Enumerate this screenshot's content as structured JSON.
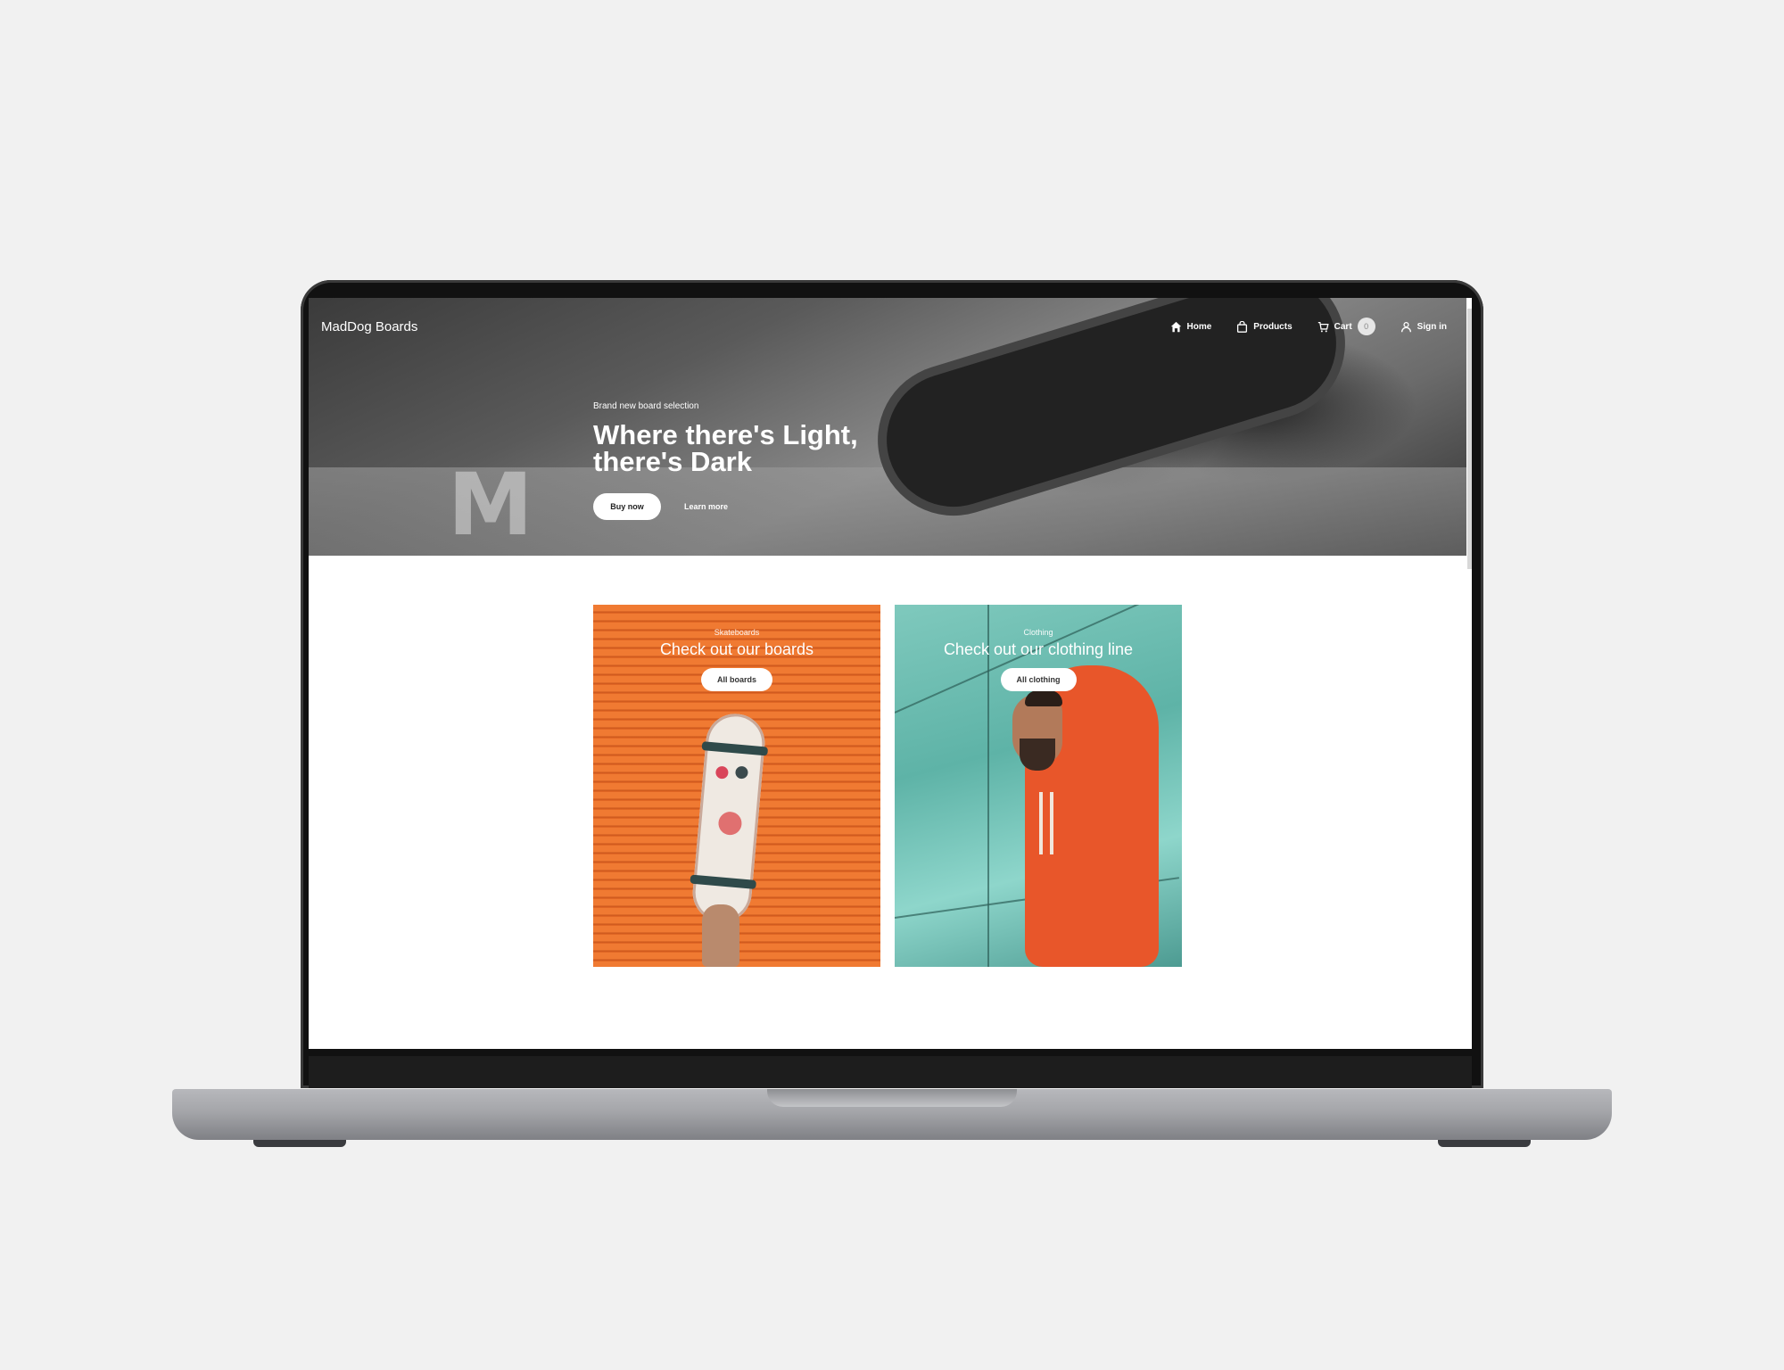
{
  "site": {
    "brand": "MadDog Boards",
    "nav": [
      {
        "label": "Home",
        "icon": "home-icon"
      },
      {
        "label": "Products",
        "icon": "shopping-bag-icon"
      },
      {
        "label": "Cart",
        "icon": "cart-icon",
        "badge": "0"
      },
      {
        "label": "Sign in",
        "icon": "user-icon"
      }
    ]
  },
  "hero": {
    "eyebrow": "Brand new board selection",
    "headline": "Where there's Light, there's Dark",
    "primary_button": "Buy now",
    "secondary_link": "Learn more"
  },
  "categories": [
    {
      "kicker": "Skateboards",
      "title": "Check out our boards",
      "button": "All boards",
      "accent": "#f07a32"
    },
    {
      "kicker": "Clothing",
      "title": "Check out our clothing line",
      "button": "All clothing",
      "accent": "#6fc2b5"
    }
  ]
}
